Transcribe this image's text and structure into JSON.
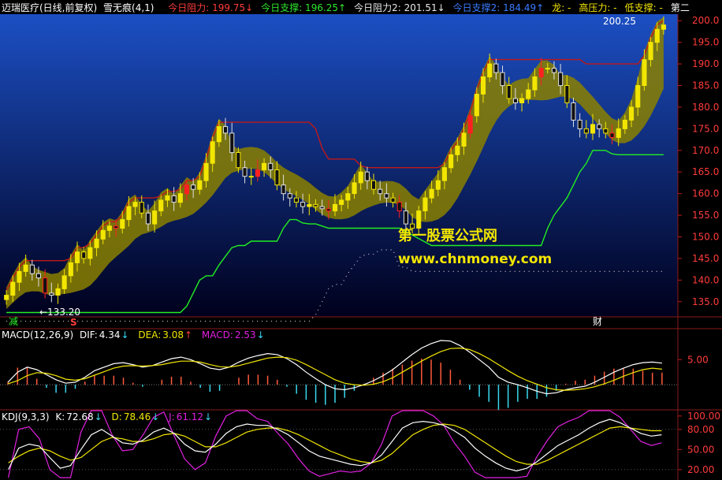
{
  "header": {
    "stock": "迈瑞医疗(日线,前复权)",
    "indicator": "雪无痕(4,1)",
    "items": [
      {
        "label": "今日阻力:",
        "value": "199.75",
        "arrow": "↓",
        "color": "#ff3b3b"
      },
      {
        "label": "今日支撑:",
        "value": "196.25",
        "arrow": "↑",
        "color": "#2ee82e"
      },
      {
        "label": "今日阻力2:",
        "value": "201.51",
        "arrow": "↓",
        "color": "#e8e8e8"
      },
      {
        "label": "今日支撑2:",
        "value": "184.49",
        "arrow": "↑",
        "color": "#3a7bff"
      },
      {
        "label": "龙:",
        "value": "-",
        "arrow": "",
        "color": "#f2e600"
      },
      {
        "label": "高压力:",
        "value": "-",
        "arrow": "",
        "color": "#f2e600"
      },
      {
        "label": "低支撑:",
        "value": "-",
        "arrow": "",
        "color": "#f2e600"
      },
      {
        "label": "第二",
        "value": "",
        "arrow": "",
        "color": "#ffffff"
      }
    ]
  },
  "watermark": {
    "title": "第一股票公式网",
    "url": "www.chnmoney.com"
  },
  "markers": {
    "low_price_label": "←133.20",
    "high_price_label": "200.25",
    "left_bottom_1": "减",
    "left_bottom_2": "S",
    "right_bottom": "财"
  },
  "macd": {
    "title": "MACD(12,26,9)",
    "dif_label": "DIF:",
    "dif": "4.34",
    "dif_arrow": "↓",
    "dea_label": "DEA:",
    "dea": "3.08",
    "dea_arrow": "↑",
    "macd_label": "MACD:",
    "macd": "2.53",
    "macd_arrow": "↓",
    "ticks": [
      "5.00"
    ]
  },
  "kdj": {
    "title": "KDJ(9,3,3)",
    "k_label": "K:",
    "k": "72.68",
    "k_arrow": "↓",
    "d_label": "D:",
    "d": "78.46",
    "d_arrow": "↓",
    "j_label": "J:",
    "j": "61.12",
    "j_arrow": "↓",
    "ticks": [
      "100.00",
      "80.00",
      "50.00",
      "20.00"
    ]
  },
  "colors": {
    "up_candle": "#f2e600",
    "down_candle": "#ff2020",
    "neutral_candle": "#e0e0e0",
    "band_fill": "#8a8000",
    "resistance_line": "#c01818",
    "support_line": "#22ee22",
    "dotted_line": "#c8c8c8",
    "dif_line": "#ffffff",
    "dea_line": "#f2e600",
    "hist_up": "#ff5a3a",
    "hist_down": "#3ad8f0",
    "k_line": "#ffffff",
    "d_line": "#f2e600",
    "j_line": "#e020e0",
    "bg_top": "#1c4fc4",
    "bg_bottom": "#00001c"
  },
  "chart_data": [
    {
      "type": "candlestick",
      "name": "",
      "ylim": [
        131.5,
        201.5
      ],
      "y_ticks": [
        135,
        140,
        145,
        150,
        155,
        160,
        165,
        170,
        175,
        180,
        185,
        190,
        195,
        200
      ],
      "count": 100,
      "close": [
        136.5,
        139.5,
        142,
        143.5,
        141.5,
        140.5,
        137,
        136.5,
        138,
        141,
        144,
        146.5,
        145,
        147.5,
        149.5,
        151.5,
        152.5,
        152,
        154,
        157,
        158,
        155.5,
        153,
        156,
        158.5,
        159.5,
        158,
        160,
        162,
        161,
        163,
        167,
        172,
        175.5,
        174,
        169.5,
        166,
        164,
        164,
        165.5,
        167,
        165.5,
        162,
        160,
        159,
        158,
        157,
        157.5,
        157,
        156.5,
        156,
        157.5,
        158.5,
        160,
        162.5,
        165,
        163,
        161,
        160,
        159,
        158,
        156,
        153,
        152,
        156,
        159,
        161,
        163,
        166,
        169,
        171,
        174,
        178,
        183,
        187,
        190,
        188,
        185,
        182,
        181,
        182,
        184,
        187,
        189,
        189,
        188,
        185,
        181,
        177,
        175,
        174,
        176,
        175,
        174,
        173,
        175,
        177,
        180,
        185,
        191,
        195,
        198,
        199
      ]
    },
    {
      "type": "line",
      "name": "",
      "ylim": [
        -5,
        11
      ],
      "y_ticks": [
        5
      ],
      "dif": [
        0.5,
        2.5,
        3.5,
        3.0,
        2.0,
        1.0,
        0.3,
        0.5,
        1.5,
        2.8,
        3.5,
        4.2,
        4.4,
        4.0,
        3.5,
        3.8,
        4.5,
        5.2,
        5.5,
        5.0,
        4.2,
        3.3,
        3.0,
        3.5,
        4.5,
        5.3,
        5.8,
        6.2,
        6.0,
        5.2,
        4.0,
        2.5,
        1.2,
        0.0,
        -0.8,
        -1.0,
        -0.6,
        0.0,
        0.8,
        1.8,
        3.0,
        4.5,
        6.0,
        7.3,
        8.2,
        8.8,
        8.7,
        7.8,
        6.5,
        5.0,
        3.5,
        1.5,
        0.5,
        0.0,
        -0.6,
        -1.3,
        -1.8,
        -1.6,
        -1.0,
        -0.6,
        -0.3,
        0.5,
        1.5,
        2.5,
        3.3,
        4.0,
        4.4,
        4.5,
        4.3
      ],
      "dea": [
        0.2,
        0.8,
        1.8,
        2.4,
        2.3,
        1.8,
        1.1,
        0.9,
        1.2,
        1.9,
        2.6,
        3.3,
        3.7,
        3.8,
        3.7,
        3.8,
        4.0,
        4.4,
        4.7,
        4.7,
        4.5,
        4.0,
        3.6,
        3.5,
        3.8,
        4.3,
        4.8,
        5.3,
        5.5,
        5.4,
        4.9,
        4.0,
        3.0,
        2.0,
        1.0,
        0.3,
        0.0,
        -0.1,
        0.1,
        0.6,
        1.4,
        2.5,
        3.6,
        4.7,
        5.7,
        6.6,
        7.2,
        7.3,
        7.0,
        6.2,
        5.2,
        4.0,
        2.8,
        1.7,
        0.8,
        0.1,
        -0.6,
        -1.0,
        -1.1,
        -1.0,
        -0.8,
        -0.4,
        0.2,
        0.9,
        1.7,
        2.4,
        3.0,
        3.3,
        3.1
      ]
    },
    {
      "type": "line",
      "name": "",
      "ylim": [
        8,
        108
      ],
      "y_ticks": [
        20,
        50,
        80,
        100
      ],
      "k": [
        20,
        52,
        58,
        55,
        38,
        22,
        26,
        50,
        72,
        80,
        70,
        60,
        58,
        64,
        76,
        82,
        74,
        58,
        48,
        46,
        58,
        74,
        84,
        88,
        86,
        86,
        80,
        72,
        60,
        48,
        40,
        36,
        32,
        28,
        26,
        30,
        42,
        62,
        82,
        90,
        92,
        90,
        86,
        78,
        68,
        52,
        40,
        30,
        22,
        18,
        22,
        32,
        44,
        56,
        64,
        72,
        82,
        90,
        95,
        90,
        82,
        74,
        70,
        72
      ],
      "d": [
        30,
        40,
        48,
        52,
        48,
        40,
        34,
        38,
        50,
        62,
        68,
        66,
        62,
        62,
        66,
        72,
        74,
        70,
        62,
        54,
        54,
        60,
        68,
        76,
        80,
        82,
        82,
        78,
        72,
        64,
        56,
        48,
        42,
        36,
        32,
        30,
        34,
        44,
        58,
        72,
        80,
        86,
        88,
        86,
        80,
        70,
        60,
        50,
        40,
        32,
        28,
        28,
        34,
        42,
        50,
        58,
        66,
        74,
        82,
        84,
        82,
        80,
        78,
        78
      ],
      "j": [
        5,
        80,
        84,
        66,
        20,
        -10,
        5,
        76,
        110,
        116,
        72,
        48,
        50,
        72,
        98,
        106,
        70,
        36,
        20,
        30,
        70,
        100,
        112,
        112,
        96,
        92,
        74,
        58,
        36,
        18,
        10,
        14,
        18,
        16,
        18,
        30,
        58,
        100,
        128,
        126,
        116,
        100,
        86,
        60,
        40,
        16,
        2,
        -8,
        -12,
        -8,
        10,
        40,
        64,
        84,
        92,
        98,
        110,
        118,
        118,
        98,
        80,
        62,
        56,
        60
      ]
    }
  ]
}
